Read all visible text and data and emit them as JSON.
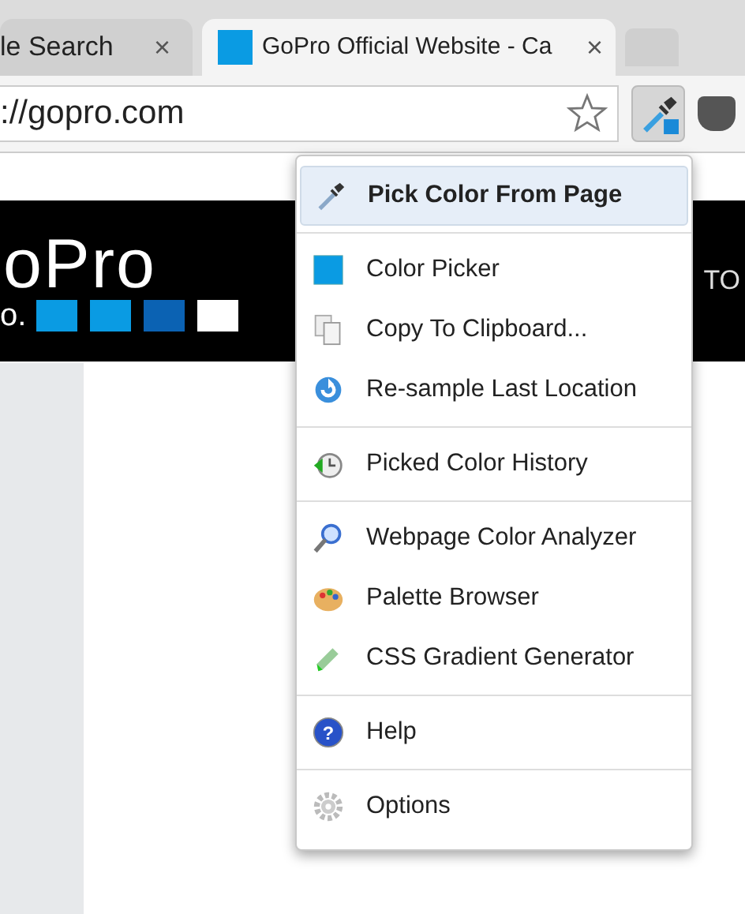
{
  "tabs": [
    {
      "title": "le Search",
      "close": "×",
      "selected": false
    },
    {
      "title": "GoPro Official Website - Ca",
      "close": "×",
      "selected": true
    }
  ],
  "address_bar": {
    "url": "://gopro.com",
    "bookmarked": false
  },
  "page": {
    "logo_text": "oPro",
    "logo_sub": "o.",
    "nav_text": "TO"
  },
  "menu": {
    "groups": [
      [
        {
          "label": "Pick Color From Page",
          "kind": "dropper",
          "selected": true
        }
      ],
      [
        {
          "label": "Color Picker",
          "kind": "swatch",
          "selected": false
        },
        {
          "label": "Copy To Clipboard...",
          "kind": "copy",
          "selected": false
        },
        {
          "label": "Re-sample Last Location",
          "kind": "refresh",
          "selected": false
        }
      ],
      [
        {
          "label": "Picked Color History",
          "kind": "history",
          "selected": false
        }
      ],
      [
        {
          "label": "Webpage Color Analyzer",
          "kind": "magnifier",
          "selected": false
        },
        {
          "label": "Palette Browser",
          "kind": "palette",
          "selected": false
        },
        {
          "label": "CSS Gradient Generator",
          "kind": "marker",
          "selected": false
        }
      ],
      [
        {
          "label": "Help",
          "kind": "help",
          "glyph": "?",
          "selected": false
        }
      ],
      [
        {
          "label": "Options",
          "kind": "gear",
          "selected": false
        }
      ]
    ]
  }
}
